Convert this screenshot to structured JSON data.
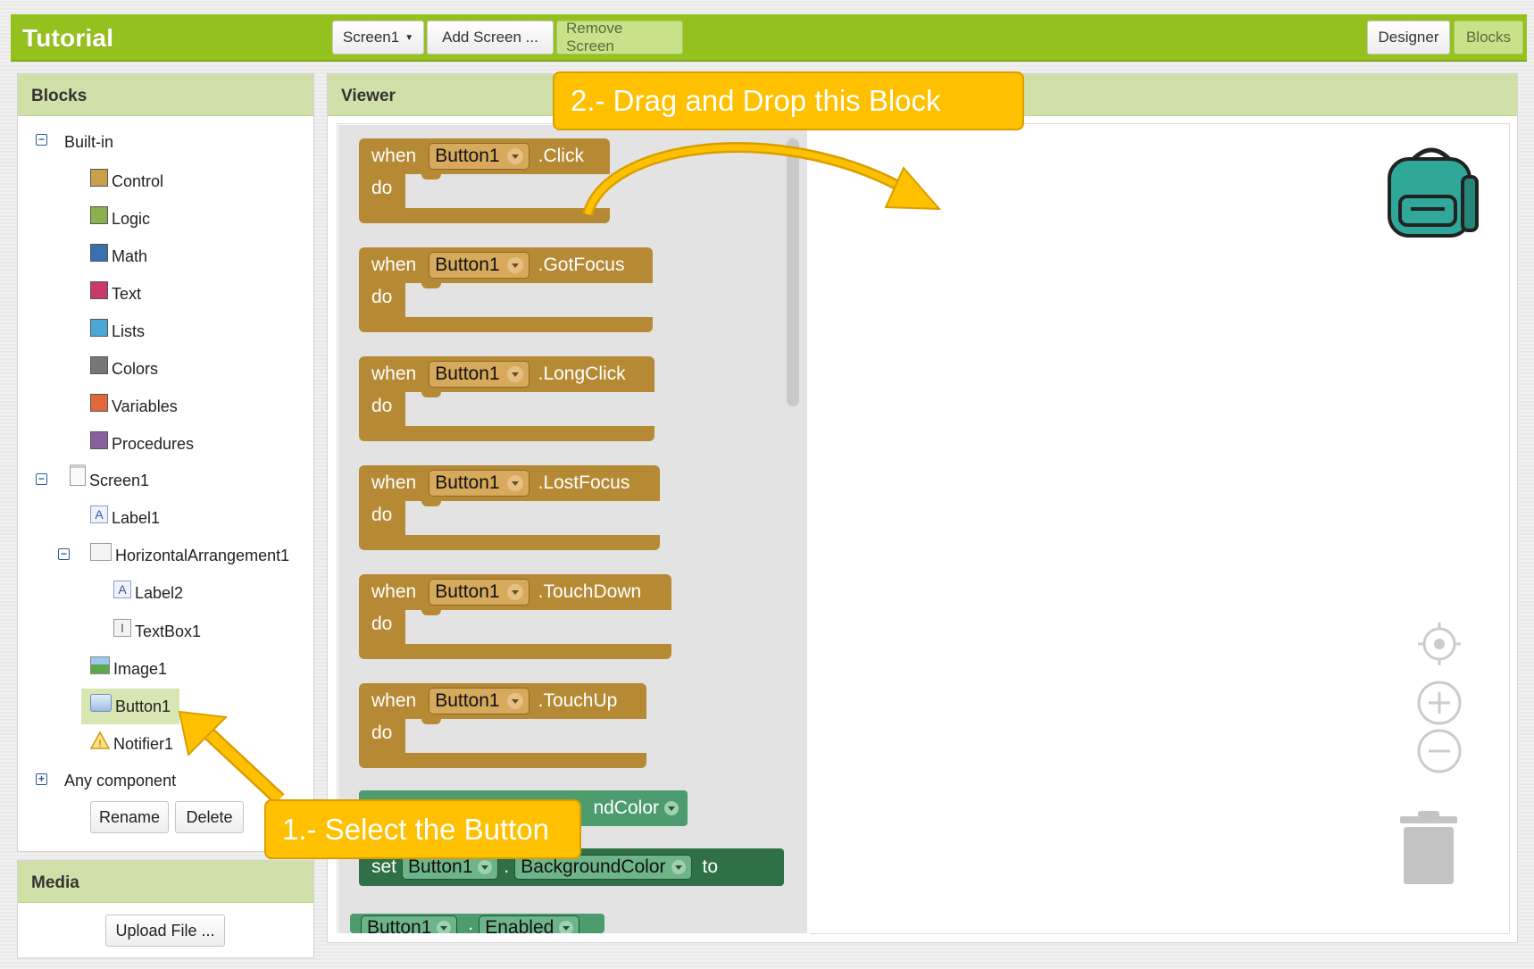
{
  "header": {
    "app_title": "Tutorial",
    "screen_select": "Screen1",
    "add_screen": "Add Screen ...",
    "remove_screen": "Remove Screen",
    "designer": "Designer",
    "blocks": "Blocks"
  },
  "blocks_panel": {
    "title": "Blocks",
    "builtin_label": "Built-in",
    "builtin": [
      {
        "label": "Control",
        "color": "#c8a04a"
      },
      {
        "label": "Logic",
        "color": "#8db04f"
      },
      {
        "label": "Math",
        "color": "#3a6fb0"
      },
      {
        "label": "Text",
        "color": "#c63a6b"
      },
      {
        "label": "Lists",
        "color": "#4aa7d8"
      },
      {
        "label": "Colors",
        "color": "#777777"
      },
      {
        "label": "Variables",
        "color": "#e0683a"
      },
      {
        "label": "Procedures",
        "color": "#8a5fa0"
      }
    ],
    "screen_label": "Screen1",
    "components": {
      "label1": "Label1",
      "horizontal": "HorizontalArrangement1",
      "label2": "Label2",
      "textbox1": "TextBox1",
      "image1": "Image1",
      "button1": "Button1",
      "notifier1": "Notifier1"
    },
    "any_component": "Any component",
    "rename": "Rename",
    "delete": "Delete"
  },
  "media_panel": {
    "title": "Media",
    "upload": "Upload File ..."
  },
  "viewer": {
    "title": "Viewer",
    "event_blocks": [
      {
        "when": "when",
        "component": "Button1",
        "event": ".Click",
        "do": "do"
      },
      {
        "when": "when",
        "component": "Button1",
        "event": ".GotFocus",
        "do": "do"
      },
      {
        "when": "when",
        "component": "Button1",
        "event": ".LongClick",
        "do": "do"
      },
      {
        "when": "when",
        "component": "Button1",
        "event": ".LostFocus",
        "do": "do"
      },
      {
        "when": "when",
        "component": "Button1",
        "event": ".TouchDown",
        "do": "do"
      },
      {
        "when": "when",
        "component": "Button1",
        "event": ".TouchUp",
        "do": "do"
      }
    ],
    "getter_partial": "ndColor",
    "setter": {
      "set": "set",
      "component": "Button1",
      "dot": ".",
      "property": "BackgroundColor",
      "to": "to"
    },
    "enabled_block": {
      "component": "Button1",
      "property": "Enabled"
    }
  },
  "callouts": {
    "step1": "1.- Select the Button",
    "step2": "2.- Drag and Drop this Block"
  },
  "colors": {
    "toolbar_green": "#95c11f",
    "panel_header": "#d0e0a9",
    "event_block": "#b68a35",
    "callout": "#ffc000",
    "backpack": "#2fa89a"
  }
}
